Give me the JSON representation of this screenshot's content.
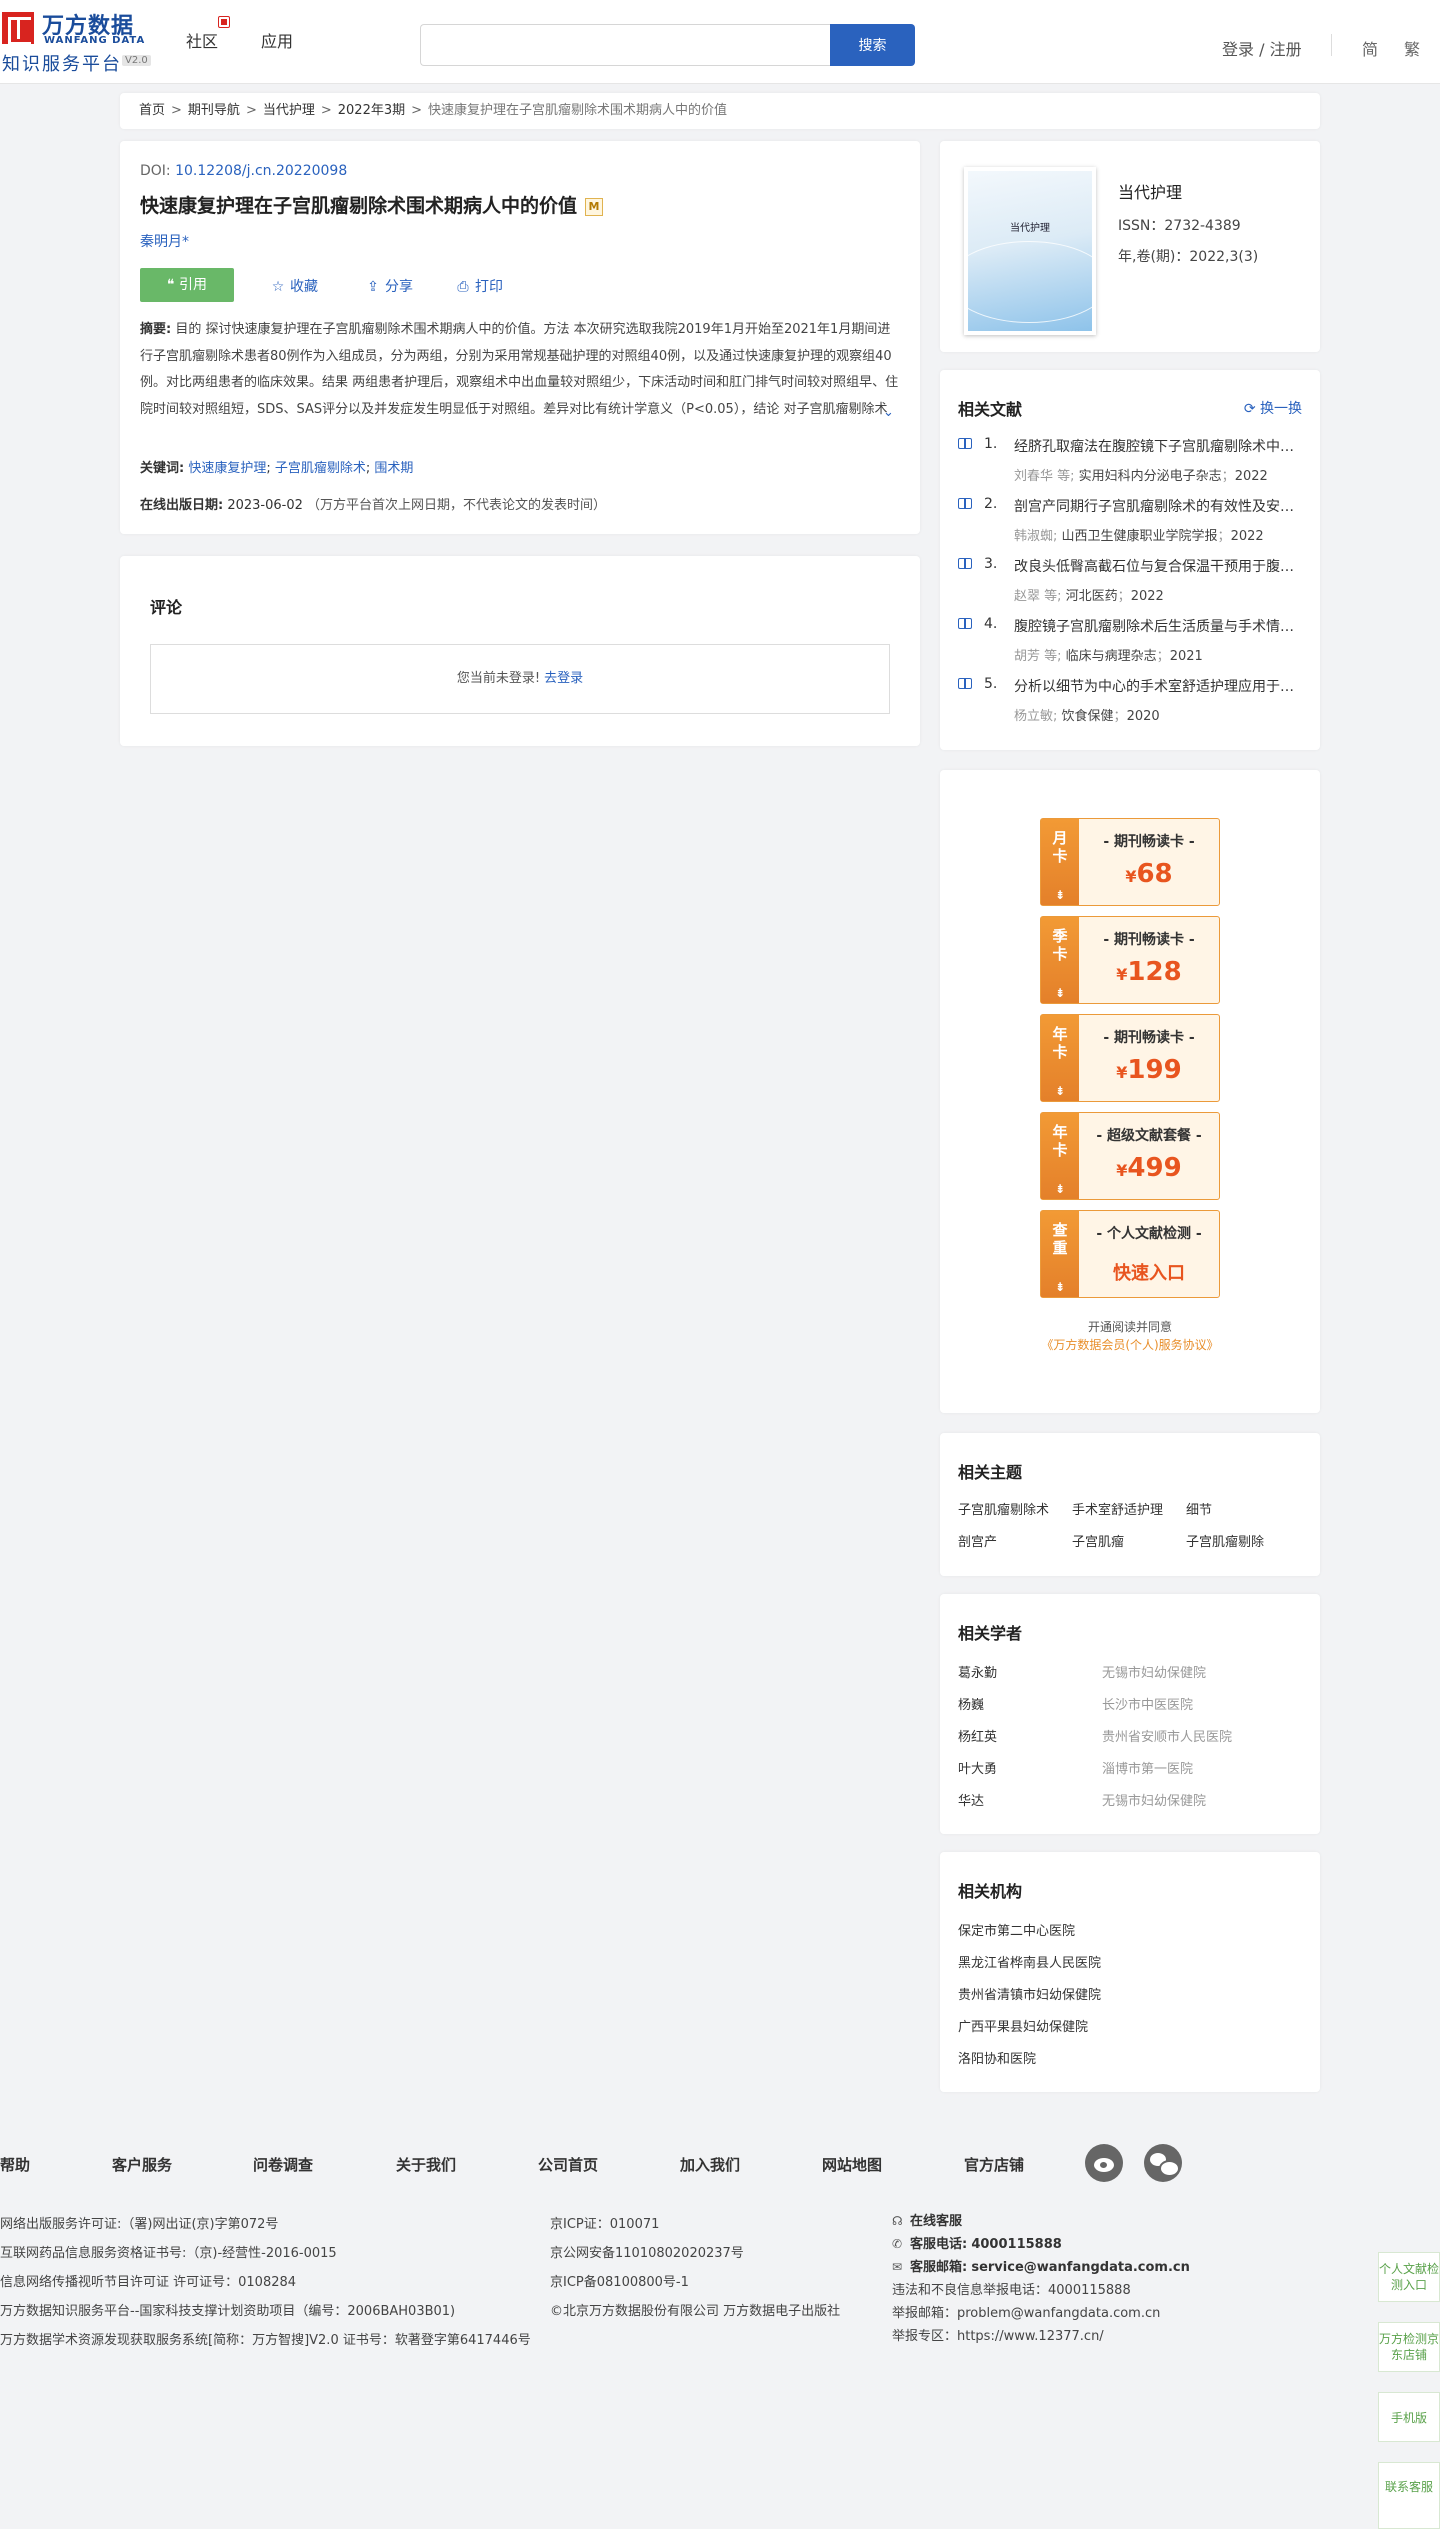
{
  "header": {
    "logo_cn": "万方数据",
    "logo_en": "WANFANG DATA",
    "logo_sub": "知识服务平台",
    "logo_version": "V2.0",
    "nav": [
      "社区",
      "应用"
    ],
    "search_placeholder": "",
    "search_button": "搜索",
    "login": "登录 / 注册",
    "lang_simplified": "简",
    "lang_traditional": "繁"
  },
  "breadcrumb": [
    "首页",
    "期刊导航",
    "当代护理",
    "2022年3期",
    "快速康复护理在子宫肌瘤剔除术围术期病人中的价值"
  ],
  "article": {
    "doi_label": "DOI: ",
    "doi": "10.12208/j.cn.20220098",
    "title": "快速康复护理在子宫肌瘤剔除术围术期病人中的价值",
    "badge": "M",
    "author": "秦明月*",
    "cite": "引用",
    "favorite": "收藏",
    "share": "分享",
    "print": "打印",
    "abstract_label": "摘要:",
    "abstract": "目的 探讨快速康复护理在子宫肌瘤剔除术围术期病人中的价值。方法 本次研究选取我院2019年1月开始至2021年1月期间进行子宫肌瘤剔除术患者80例作为入组成员，分为两组，分别为采用常规基础护理的对照组40例，以及通过快速康复护理的观察组40例。对比两组患者的临床效果。结果 两组患者护理后，观察组术中出血量较对照组少，下床活动时间和肛门排气时间较对照组早、住院时间较对照组短，SDS、SAS评分以及并发症发生明显低于对照组。差异对比有统计学意义（P<0.05），结论 对子宫肌瘤剔除术患者采取快速康复护理，缓解患者不良情绪，减少并发症的发生，提高患者生活质...",
    "keywords_label": "关键词:",
    "keywords": [
      "快速康复护理",
      "子宫肌瘤剔除术",
      "围术期"
    ],
    "pubdate_label": "在线出版日期:",
    "pubdate": "2023-06-02",
    "pubdate_note": "（万方平台首次上网日期，不代表论文的发表时间）"
  },
  "comment": {
    "title": "评论",
    "not_logged": "您当前未登录!",
    "login_link": "去登录"
  },
  "journal": {
    "cover_title": "当代护理",
    "name": "当代护理",
    "issn": "ISSN：2732-4389",
    "volume": "年,卷(期)：2022,3(3)"
  },
  "related_literature": {
    "title": "相关文献",
    "refresh": "换一换",
    "items": [
      {
        "num": "1.",
        "title": "经脐孔取瘤法在腹腔镜下子宫肌瘤剔除术中的应用价值",
        "authors": "刘春华  等;",
        "source": "实用妇科内分泌电子杂志",
        "year": "2022"
      },
      {
        "num": "2.",
        "title": "剖宫产同期行子宫肌瘤剔除术的有效性及安全性分析",
        "authors": "韩淑蜘;",
        "source": "山西卫生健康职业学院学报",
        "year": "2022"
      },
      {
        "num": "3.",
        "title": "改良头低臀高截石位与复合保温干预用于腹腔镜手术患者",
        "authors": "赵翠  等;",
        "source": "河北医药",
        "year": "2022"
      },
      {
        "num": "4.",
        "title": "腹腔镜子宫肌瘤剔除术后生活质量与手术情况分析",
        "authors": "胡芳  等;",
        "source": "临床与病理杂志",
        "year": "2021"
      },
      {
        "num": "5.",
        "title": "分析以细节为中心的手术室舒适护理应用于子宫肌瘤患者",
        "authors": "杨立敏;",
        "source": "饮食保健",
        "year": "2020"
      }
    ]
  },
  "vip": {
    "cards": [
      {
        "side": "月卡",
        "name": "- 期刊畅读卡 -",
        "currency": "¥",
        "price": "68"
      },
      {
        "side": "季卡",
        "name": "- 期刊畅读卡 -",
        "currency": "¥",
        "price": "128"
      },
      {
        "side": "年卡",
        "name": "- 期刊畅读卡 -",
        "currency": "¥",
        "price": "199"
      },
      {
        "side": "年卡",
        "name": "- 超级文献套餐 -",
        "currency": "¥",
        "price": "499"
      },
      {
        "side": "查重",
        "name": "- 个人文献检测 -",
        "link": "快速入口"
      }
    ],
    "arrow": "⇟",
    "agree": "开通阅读并同意",
    "agreement": "《万方数据会员(个人)服务协议》"
  },
  "topics": {
    "title": "相关主题",
    "items": [
      "子宫肌瘤剔除术",
      "手术室舒适护理",
      "细节",
      "剖宫产",
      "子宫肌瘤",
      "子宫肌瘤剔除"
    ]
  },
  "scholars": {
    "title": "相关学者",
    "items": [
      {
        "name": "葛永勤",
        "org": "无锡市妇幼保健院"
      },
      {
        "name": "杨巍",
        "org": "长沙市中医医院"
      },
      {
        "name": "杨红英",
        "org": "贵州省安顺市人民医院"
      },
      {
        "name": "叶大勇",
        "org": "淄博市第一医院"
      },
      {
        "name": "华达",
        "org": "无锡市妇幼保健院"
      }
    ]
  },
  "institutions": {
    "title": "相关机构",
    "items": [
      "保定市第二中心医院",
      "黑龙江省桦南县人民医院",
      "贵州省清镇市妇幼保健院",
      "广西平果县妇幼保健院",
      "洛阳协和医院"
    ]
  },
  "footer": {
    "links": [
      "帮助",
      "客户服务",
      "问卷调查",
      "关于我们",
      "公司首页",
      "加入我们",
      "网站地图",
      "官方店铺"
    ],
    "col1": [
      "网络出版服务许可证:（署)网出证(京)字第072号",
      "互联网药品信息服务资格证书号:（京)-经营性-2016-0015",
      "信息网络传播视听节目许可证 许可证号：0108284",
      "万方数据知识服务平台--国家科技支撑计划资助项目（编号：2006BAH03B01)",
      "万方数据学术资源发现获取服务系统[简称：万方智搜]V2.0 证书号：软著登字第6417446号"
    ],
    "col2": [
      "京ICP证：010071",
      "京公网安备11010802020237号",
      "京ICP备08100800号-1",
      "©北京万方数据股份有限公司 万方数据电子出版社"
    ],
    "online_service": "在线客服",
    "phone_label": "客服电话:",
    "phone": "4000115888",
    "email_label": "客服邮箱:",
    "email": "service@wanfangdata.com.cn",
    "report_phone": "违法和不良信息举报电话：4000115888",
    "report_email": "举报邮箱：problem@wanfangdata.com.cn",
    "report_site": "举报专区：https://www.12377.cn/"
  },
  "float_bar": [
    "个人文献检测入口",
    "万方检测京东店铺",
    "手机版",
    "联系客服"
  ]
}
